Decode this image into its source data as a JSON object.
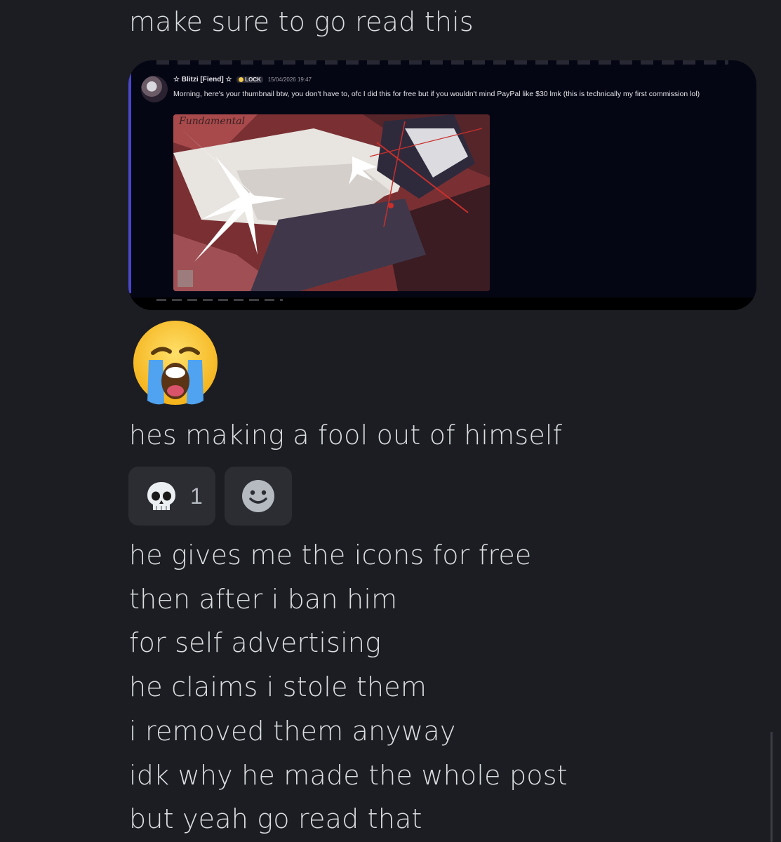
{
  "messages": {
    "line1": "make sure to go read this",
    "line2": "hes making a fool out of himself",
    "line3": "he gives me the icons for free",
    "line4": "then after i ban him",
    "line5": "for self advertising",
    "line6": "he claims i stole them",
    "line7": "i removed them anyway",
    "line8": "idk why he made the whole post",
    "line9": "but yeah go read that"
  },
  "embed": {
    "author": "☆ Blitzi [Fiend] ☆",
    "tag": "LOCK",
    "timestamp": "15/04/2026 19:47",
    "text": "Morning, here's your thumbnail btw, you don't have to, ofc I did this for free but if you wouldn't mind PayPal like $30 lmk (this is technically my first commission lol)",
    "art_signature": "Fundamental"
  },
  "big_emoji": "loudly-crying-face-icon",
  "reactions": [
    {
      "emoji": "skull-icon",
      "count": "1"
    },
    {
      "emoji": "add-reaction-icon"
    }
  ],
  "colors": {
    "background": "#1c1d22",
    "text": "#dbdee1",
    "reaction_bg": "#2b2d33",
    "embed_accent": "#4a47c9"
  }
}
